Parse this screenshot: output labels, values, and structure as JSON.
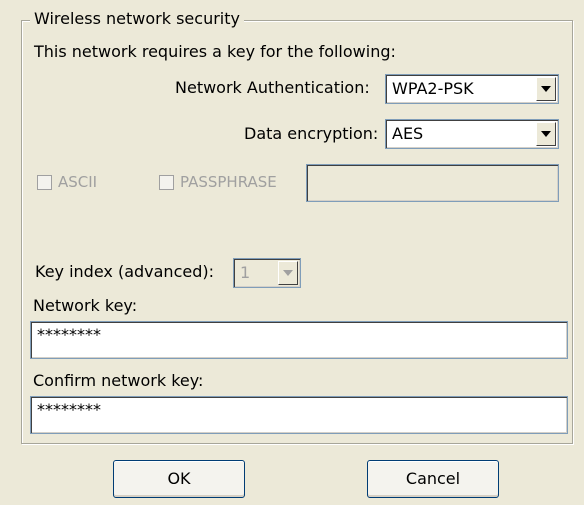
{
  "group": {
    "legend": "Wireless network security",
    "intro": "This network requires a key for the following:"
  },
  "auth": {
    "label": "Network Authentication:",
    "value": "WPA2-PSK"
  },
  "encryption": {
    "label": "Data encryption:",
    "value": "AES"
  },
  "options": {
    "ascii": "ASCII",
    "passphrase": "PASSPHRASE",
    "passphrase_value": ""
  },
  "key_index": {
    "label": "Key index (advanced):",
    "value": "1"
  },
  "network_key": {
    "label": "Network key:",
    "value": "********"
  },
  "confirm_key": {
    "label": "Confirm network key:",
    "value": "********"
  },
  "buttons": {
    "ok": "OK",
    "cancel": "Cancel"
  },
  "colors": {
    "dialog_bg": "#ece9d8",
    "disabled_text": "#a0a0a0",
    "button_border": "#003c74"
  },
  "icons": {
    "dropdown": "chevron-down-icon",
    "checkbox": "checkbox-icon"
  }
}
